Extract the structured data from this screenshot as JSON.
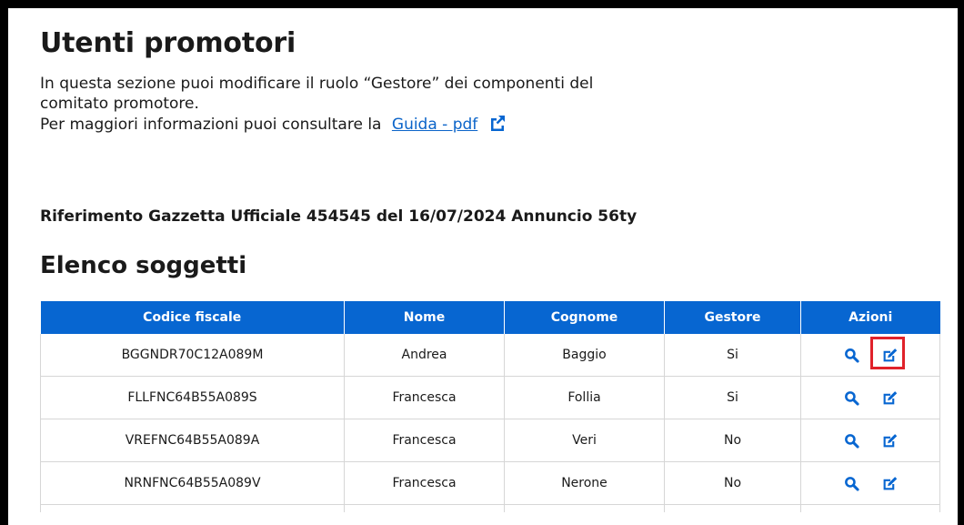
{
  "page": {
    "title": "Utenti promotori",
    "intro_line1": "In questa sezione puoi modificare il ruolo “Gestore” dei componenti del comitato promotore.",
    "intro_line2_prefix": "Per maggiori informazioni puoi consultare la",
    "guide_link": "Guida - pdf",
    "reference": "Riferimento Gazzetta Ufficiale 454545 del 16/07/2024 Annuncio 56ty",
    "section_title": "Elenco soggetti"
  },
  "table": {
    "headers": [
      "Codice fiscale",
      "Nome",
      "Cognome",
      "Gestore",
      "Azioni"
    ],
    "rows": [
      {
        "codice": "BGGNDR70C12A089M",
        "nome": "Andrea",
        "cognome": "Baggio",
        "gestore": "Si"
      },
      {
        "codice": "FLLFNC64B55A089S",
        "nome": "Francesca",
        "cognome": "Follia",
        "gestore": "Si"
      },
      {
        "codice": "VREFNC64B55A089A",
        "nome": "Francesca",
        "cognome": "Veri",
        "gestore": "No"
      },
      {
        "codice": "NRNFNC64B55A089V",
        "nome": "Francesca",
        "cognome": "Nerone",
        "gestore": "No"
      }
    ]
  },
  "colors": {
    "header_bg": "#0766d1",
    "link": "#0b64c9",
    "icon": "#0766d1",
    "highlight": "#e0222a"
  },
  "icons": {
    "view": "search-icon",
    "edit": "edit-icon",
    "external": "external-link-icon"
  }
}
